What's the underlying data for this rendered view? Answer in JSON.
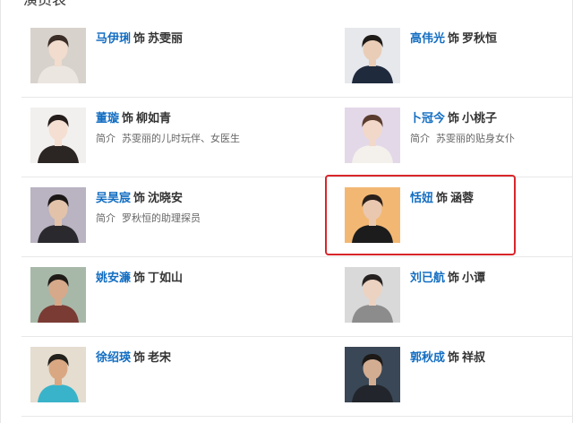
{
  "section": {
    "title": "演员表"
  },
  "cast": [
    {
      "actor": "马伊琍",
      "shi": "饰",
      "role": "苏雯丽",
      "desc_label": "",
      "desc": "",
      "bg": "#d8d2cc",
      "skin": "#f1dccd",
      "hair": "#3a2c26",
      "cloth": "#ece6e0"
    },
    {
      "actor": "高伟光",
      "shi": "饰",
      "role": "罗秋恒",
      "desc_label": "",
      "desc": "",
      "bg": "#e6e8ec",
      "skin": "#e9cdb6",
      "hair": "#1e1a18",
      "cloth": "#1f2a3d"
    },
    {
      "actor": "董璇",
      "shi": "饰",
      "role": "柳如青",
      "desc_label": "简介",
      "desc": "苏雯丽的儿时玩伴、女医生",
      "bg": "#f2f0ee",
      "skin": "#f4dfd2",
      "hair": "#241d1b",
      "cloth": "#2b2523"
    },
    {
      "actor": "卜冠今",
      "shi": "饰",
      "role": "小桃子",
      "desc_label": "简介",
      "desc": "苏雯丽的贴身女仆",
      "bg": "#e3d8e8",
      "skin": "#f2d8c8",
      "hair": "#5a3d2e",
      "cloth": "#f4f0ec"
    },
    {
      "actor": "吴昊宸",
      "shi": "饰",
      "role": "沈晓安",
      "desc_label": "简介",
      "desc": "罗秋恒的助理探员",
      "bg": "#b9b3c2",
      "skin": "#e2c3aa",
      "hair": "#1b1716",
      "cloth": "#2a2a2e"
    },
    {
      "actor": "恬妞",
      "shi": "饰",
      "role": "涵蓉",
      "desc_label": "",
      "desc": "",
      "bg": "#f2b873",
      "skin": "#eac8b0",
      "hair": "#2a201c",
      "cloth": "#1c1c1c"
    },
    {
      "actor": "姚安濂",
      "shi": "饰",
      "role": "丁如山",
      "desc_label": "",
      "desc": "",
      "bg": "#a7b8a9",
      "skin": "#d6a98a",
      "hair": "#1f1a17",
      "cloth": "#7a3b34"
    },
    {
      "actor": "刘已航",
      "shi": "饰",
      "role": "小谭",
      "desc_label": "",
      "desc": "",
      "bg": "#d9d9d9",
      "skin": "#ecd2c0",
      "hair": "#252120",
      "cloth": "#8c8c8c"
    },
    {
      "actor": "徐绍瑛",
      "shi": "饰",
      "role": "老宋",
      "desc_label": "",
      "desc": "",
      "bg": "#e4ddd0",
      "skin": "#d9a882",
      "hair": "#22201d",
      "cloth": "#39b3c9"
    },
    {
      "actor": "郭秋成",
      "shi": "饰",
      "role": "祥叔",
      "desc_label": "",
      "desc": "",
      "bg": "#3a4756",
      "skin": "#d3ad92",
      "hair": "#1c1917",
      "cloth": "#22262c"
    }
  ],
  "highlight": {
    "color": "#d9262b",
    "target": "恬妞"
  },
  "colors": {
    "link": "#136ec2",
    "text": "#333333",
    "muted": "#666666",
    "divider": "#e8e8e8"
  }
}
